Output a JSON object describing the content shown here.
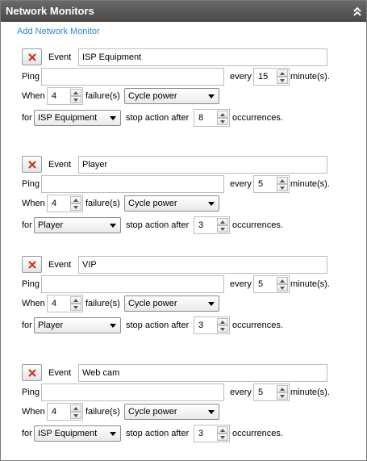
{
  "panel": {
    "title": "Network Monitors",
    "add_link": "Add Network Monitor"
  },
  "labels": {
    "event": "Event",
    "ping": "Ping",
    "every": "every",
    "minutes": "minute(s).",
    "when": "When",
    "failures": "failure(s)",
    "for": "for",
    "stop_action_after": "stop action after",
    "occurrences": "occurrences."
  },
  "monitors": [
    {
      "event": "ISP Equipment",
      "ping": "",
      "every": "15",
      "failures": "4",
      "action": "Cycle power",
      "for": "ISP Equipment",
      "stop_after": "8"
    },
    {
      "event": "Player",
      "ping": "",
      "every": "5",
      "failures": "4",
      "action": "Cycle power",
      "for": "Player",
      "stop_after": "3"
    },
    {
      "event": "VIP",
      "ping": "",
      "every": "5",
      "failures": "4",
      "action": "Cycle power",
      "for": "Player",
      "stop_after": "3"
    },
    {
      "event": "Web cam",
      "ping": "",
      "every": "5",
      "failures": "4",
      "action": "Cycle power",
      "for": "ISP Equipment",
      "stop_after": "3"
    }
  ]
}
